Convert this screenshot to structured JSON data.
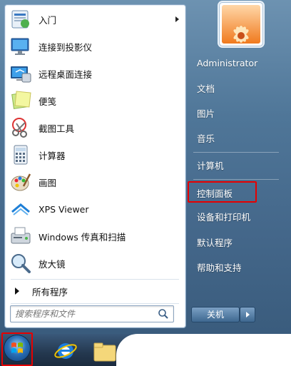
{
  "left_items": [
    {
      "label": "入门",
      "has_submenu": true,
      "icon": "getting-started-icon"
    },
    {
      "label": "连接到投影仪",
      "icon": "projector-icon"
    },
    {
      "label": "远程桌面连接",
      "icon": "remote-desktop-icon"
    },
    {
      "label": "便笺",
      "icon": "sticky-notes-icon"
    },
    {
      "label": "截图工具",
      "icon": "snipping-tool-icon"
    },
    {
      "label": "计算器",
      "icon": "calculator-icon"
    },
    {
      "label": "画图",
      "icon": "paint-icon"
    },
    {
      "label": "XPS Viewer",
      "icon": "xps-viewer-icon"
    },
    {
      "label": "Windows 传真和扫描",
      "icon": "fax-scan-icon"
    },
    {
      "label": "放大镜",
      "icon": "magnifier-icon"
    }
  ],
  "all_programs": {
    "label": "所有程序"
  },
  "search": {
    "placeholder": "搜索程序和文件"
  },
  "right_items": [
    {
      "label": "Administrator"
    },
    {
      "label": "文档"
    },
    {
      "label": "图片"
    },
    {
      "label": "音乐"
    },
    {
      "label": "计算机"
    },
    {
      "label": "控制面板",
      "highlighted": true
    },
    {
      "label": "设备和打印机"
    },
    {
      "label": "默认程序"
    },
    {
      "label": "帮助和支持"
    }
  ],
  "shutdown": {
    "label": "关机"
  },
  "colors": {
    "highlight_box": "#e60000",
    "menu_glass": "#4f7698"
  },
  "taskbar": {
    "items": [
      "start-orb",
      "internet-explorer-icon",
      "folder-icon"
    ]
  }
}
